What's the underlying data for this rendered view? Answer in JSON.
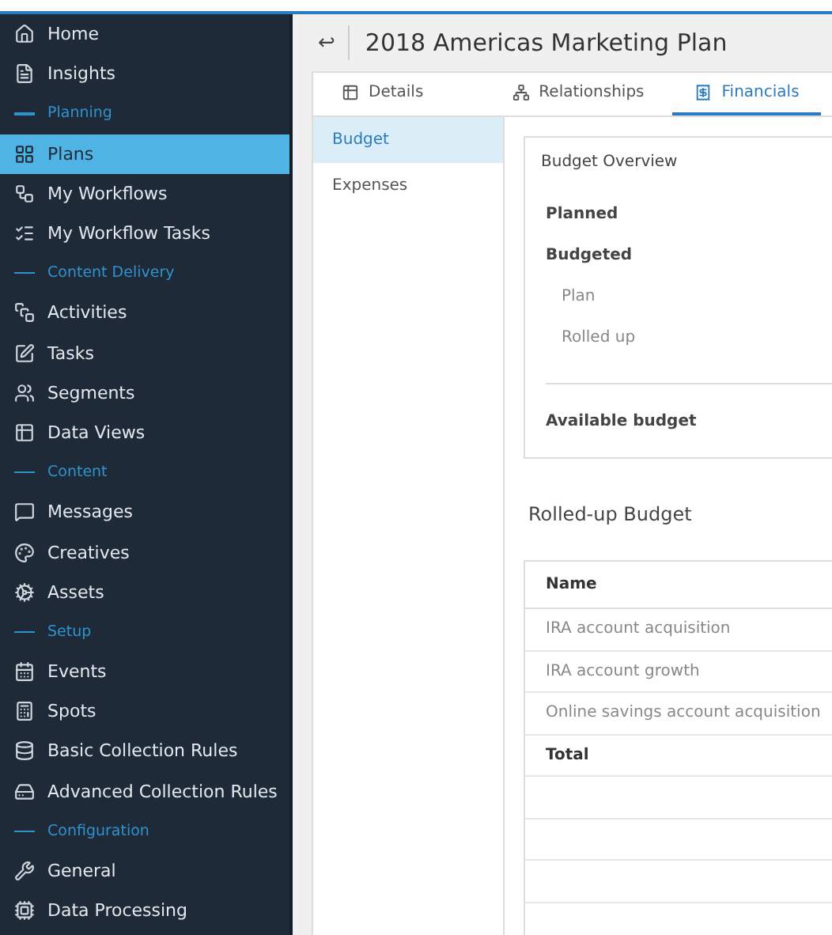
{
  "sidebar": {
    "items": [
      {
        "kind": "item",
        "label": "Home",
        "selected": false
      },
      {
        "kind": "item",
        "label": "Insights",
        "selected": false
      },
      {
        "kind": "section",
        "label": "Planning"
      },
      {
        "kind": "item",
        "label": "Plans",
        "selected": true
      },
      {
        "kind": "item",
        "label": "My Workflows",
        "selected": false
      },
      {
        "kind": "item",
        "label": "My Workflow Tasks",
        "selected": false
      },
      {
        "kind": "section",
        "label": "Content Delivery"
      },
      {
        "kind": "item",
        "label": "Activities",
        "selected": false
      },
      {
        "kind": "item",
        "label": "Tasks",
        "selected": false
      },
      {
        "kind": "item",
        "label": "Segments",
        "selected": false
      },
      {
        "kind": "item",
        "label": "Data Views",
        "selected": false
      },
      {
        "kind": "section",
        "label": "Content"
      },
      {
        "kind": "item",
        "label": "Messages",
        "selected": false
      },
      {
        "kind": "item",
        "label": "Creatives",
        "selected": false
      },
      {
        "kind": "item",
        "label": "Assets",
        "selected": false
      },
      {
        "kind": "section",
        "label": "Setup"
      },
      {
        "kind": "item",
        "label": "Events",
        "selected": false
      },
      {
        "kind": "item",
        "label": "Spots",
        "selected": false
      },
      {
        "kind": "item",
        "label": "Basic Collection Rules",
        "selected": false
      },
      {
        "kind": "item",
        "label": "Advanced Collection Rules",
        "selected": false
      },
      {
        "kind": "section",
        "label": "Configuration"
      },
      {
        "kind": "item",
        "label": "General",
        "selected": false
      },
      {
        "kind": "item",
        "label": "Data Processing",
        "selected": false
      }
    ]
  },
  "header": {
    "back": "↩",
    "title": "2018 Americas Marketing Plan"
  },
  "tabs": [
    {
      "label": "Details",
      "selected": false
    },
    {
      "label": "Relationships",
      "selected": false
    },
    {
      "label": "Financials",
      "selected": true
    }
  ],
  "subnav": [
    {
      "label": "Budget",
      "selected": true
    },
    {
      "label": "Expenses",
      "selected": false
    }
  ],
  "budget_overview": {
    "title": "Budget Overview",
    "lines": [
      {
        "kind": "main",
        "label": "Planned"
      },
      {
        "kind": "main",
        "label": "Budgeted"
      },
      {
        "kind": "sub",
        "label": "Plan"
      },
      {
        "kind": "sub",
        "label": "Rolled up"
      },
      {
        "kind": "divider"
      },
      {
        "kind": "main",
        "label": "Available budget"
      }
    ]
  },
  "rolled_up": {
    "title": "Rolled-up Budget",
    "columns": [
      "Name"
    ],
    "rows": [
      {
        "kind": "row",
        "name": "IRA account acquisition"
      },
      {
        "kind": "row",
        "name": "IRA account growth"
      },
      {
        "kind": "row",
        "name": "Online savings account acquisition"
      },
      {
        "kind": "total",
        "name": "Total"
      }
    ]
  }
}
